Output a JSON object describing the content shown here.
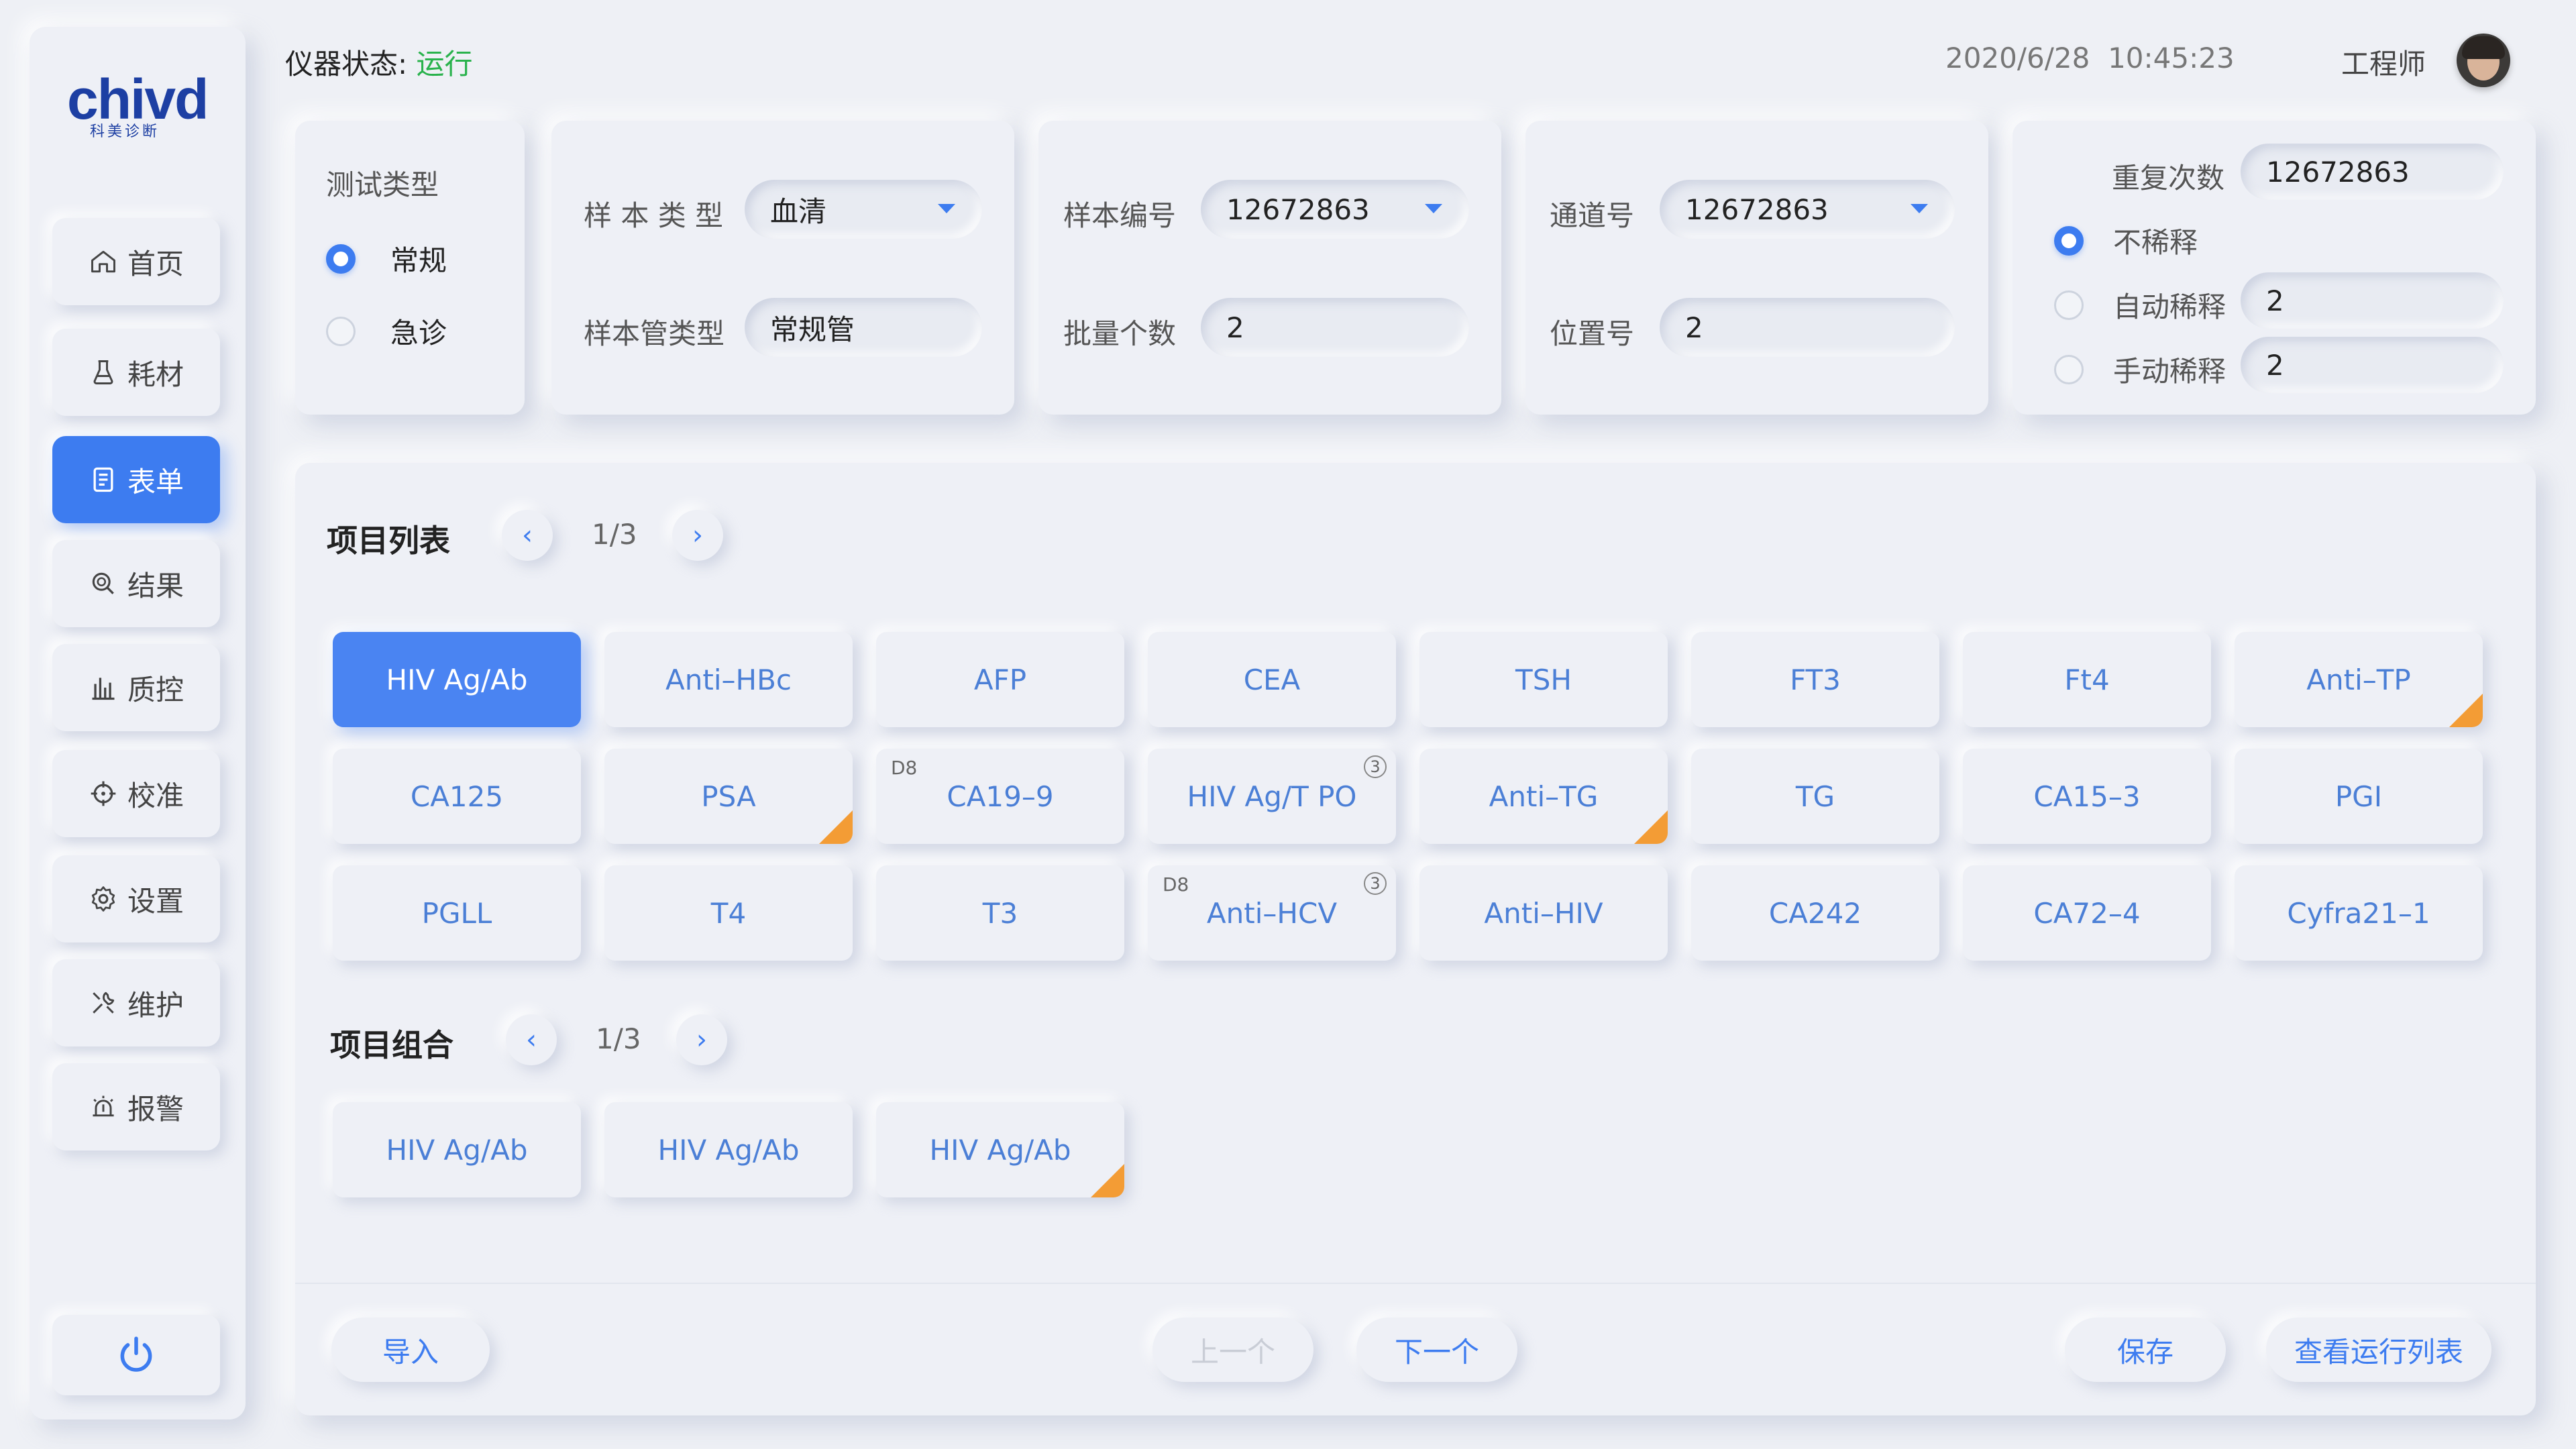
{
  "logo": {
    "word": "chivd",
    "subtitle": "科美诊断"
  },
  "header": {
    "status_label": "仪器状态: ",
    "status_value": "运行",
    "date": "2020/6/28",
    "time": "10:45:23",
    "user": "工程师"
  },
  "sidebar": {
    "items": [
      {
        "label": "首页",
        "icon": "home-icon"
      },
      {
        "label": "耗材",
        "icon": "flask-icon"
      },
      {
        "label": "表单",
        "icon": "form-icon",
        "active": true
      },
      {
        "label": "结果",
        "icon": "search-icon"
      },
      {
        "label": "质控",
        "icon": "bar-chart-icon"
      },
      {
        "label": "校准",
        "icon": "crosshair-icon"
      },
      {
        "label": "设置",
        "icon": "gear-icon"
      },
      {
        "label": "维护",
        "icon": "wrench-icon"
      },
      {
        "label": "报警",
        "icon": "alarm-icon"
      }
    ],
    "power_icon": "power-icon"
  },
  "test_type": {
    "title": "测试类型",
    "options": [
      {
        "label": "常规",
        "selected": true
      },
      {
        "label": "急诊",
        "selected": false
      }
    ]
  },
  "sample": {
    "type_label": "样 本 类 型",
    "type_value": "血清",
    "tube_label": "样本管类型",
    "tube_value": "常规管"
  },
  "sample_no": {
    "no_label": "样本编号",
    "no_value": "12672863",
    "batch_label": "批量个数",
    "batch_value": "2"
  },
  "channel": {
    "channel_label": "通道号",
    "channel_value": "12672863",
    "position_label": "位置号",
    "position_value": "2"
  },
  "dilution": {
    "repeat_label": "重复次数",
    "repeat_value": "12672863",
    "options": [
      {
        "label": "不稀释",
        "selected": true,
        "value": ""
      },
      {
        "label": "自动稀释",
        "selected": false,
        "value": "2"
      },
      {
        "label": "手动稀释",
        "selected": false,
        "value": "2"
      }
    ]
  },
  "project_list": {
    "title": "项目列表",
    "page": "1/3",
    "prev": "‹",
    "next": "›",
    "items": [
      {
        "label": "HIV Ag/Ab",
        "active": true
      },
      {
        "label": "Anti–HBc"
      },
      {
        "label": "AFP"
      },
      {
        "label": "CEA"
      },
      {
        "label": "TSH"
      },
      {
        "label": "FT3"
      },
      {
        "label": "Ft4"
      },
      {
        "label": "Anti–TP",
        "corner": true
      },
      {
        "label": "CA125"
      },
      {
        "label": "PSA",
        "corner": true
      },
      {
        "label": "CA19–9",
        "tag": "D8"
      },
      {
        "label": "HIV Ag/T PO",
        "badge": "3"
      },
      {
        "label": "Anti–TG",
        "corner": true
      },
      {
        "label": "TG"
      },
      {
        "label": "CA15–3"
      },
      {
        "label": "PGI"
      },
      {
        "label": "PGLL"
      },
      {
        "label": "T4"
      },
      {
        "label": "T3"
      },
      {
        "label": "Anti–HCV",
        "tag": "D8",
        "badge": "3"
      },
      {
        "label": "Anti–HIV"
      },
      {
        "label": "CA242"
      },
      {
        "label": "CA72–4"
      },
      {
        "label": "Cyfra21–1"
      }
    ]
  },
  "project_group": {
    "title": "项目组合",
    "page": "1/3",
    "prev": "‹",
    "next": "›",
    "items": [
      {
        "label": "HIV Ag/Ab"
      },
      {
        "label": "HIV Ag/Ab"
      },
      {
        "label": "HIV Ag/Ab",
        "corner": true
      }
    ]
  },
  "footer": {
    "import": "导入",
    "prev": "上一个",
    "next": "下一个",
    "save": "保存",
    "run_list": "查看运行列表"
  },
  "colors": {
    "accent": "#3d7cf0",
    "running": "#29b24c",
    "corner": "#f39c35",
    "background": "#eef0f5"
  }
}
